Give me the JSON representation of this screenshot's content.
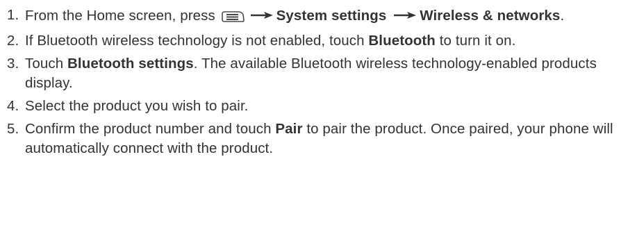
{
  "steps": [
    {
      "number": "1.",
      "parts": {
        "t1": "From the Home screen, press",
        "b1": "System settings",
        "b2": "Wireless & networks",
        "t2": "."
      },
      "icons": [
        "menu-key-icon",
        "arrow-right-icon",
        "arrow-right-icon"
      ]
    },
    {
      "number": "2.",
      "parts": {
        "t1": "If Bluetooth wireless technology is not enabled, touch ",
        "b1": "Bluetooth",
        "t2": " to turn it on."
      }
    },
    {
      "number": "3.",
      "parts": {
        "t1": "Touch ",
        "b1": "Bluetooth settings",
        "t2": ". The available Bluetooth wireless technology-enabled products display."
      }
    },
    {
      "number": "4.",
      "parts": {
        "t1": "Select the product you wish to pair."
      }
    },
    {
      "number": "5.",
      "parts": {
        "t1": "Confirm the product number and touch ",
        "b1": "Pair",
        "t2": " to pair the product. Once paired, your phone will automatically connect with the product."
      }
    }
  ],
  "colors": {
    "text": "#333333",
    "icon": "#4a4a4a"
  }
}
